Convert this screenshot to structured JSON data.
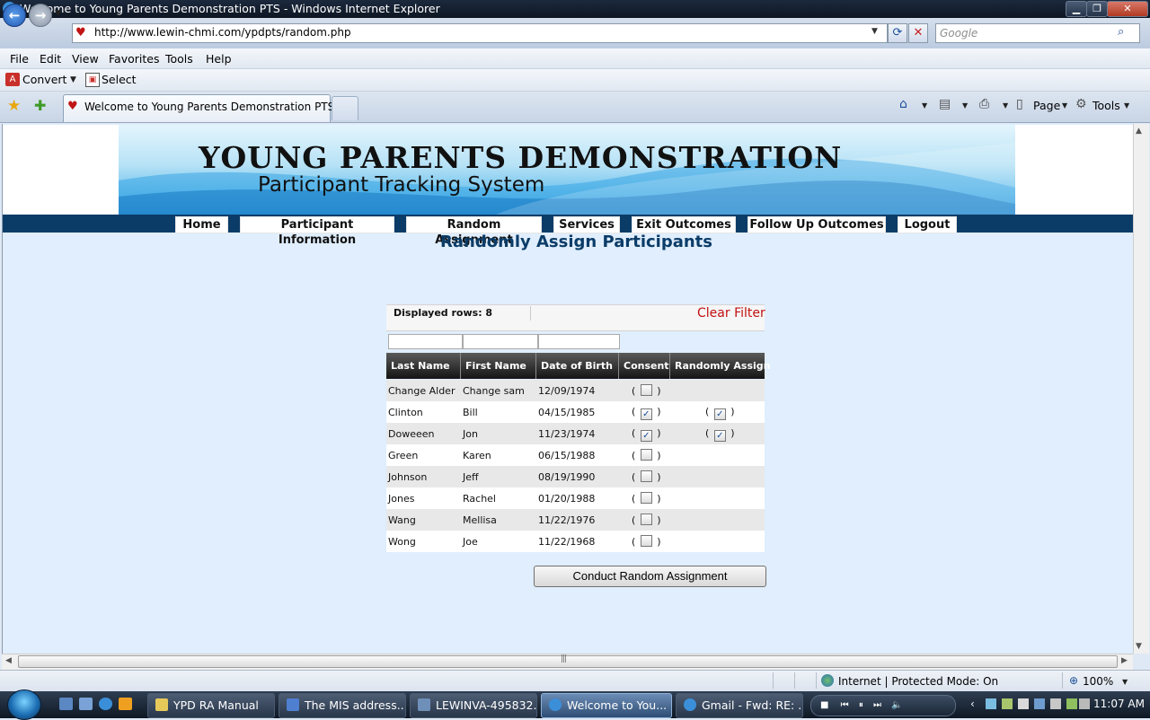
{
  "window": {
    "title": "Welcome to Young Parents Demonstration PTS - Windows Internet Explorer",
    "min": "▁",
    "max": "❐",
    "close": "✕"
  },
  "browser": {
    "address": "http://www.lewin-chmi.com/ypdpts/random.php",
    "search_placeholder": "Google",
    "menu": [
      "File",
      "Edit",
      "View",
      "Favorites",
      "Tools",
      "Help"
    ],
    "convert_label": "Convert",
    "select_label": "Select",
    "tab_title": "Welcome to Young Parents Demonstration PTS",
    "page_label": "Page",
    "tools_label": "Tools",
    "zone": "Internet | Protected Mode: On",
    "zoom": "100%"
  },
  "site": {
    "banner_title": "YOUNG PARENTS DEMONSTRATION",
    "banner_subtitle": "Participant Tracking System",
    "nav": [
      "Home",
      "Participant Information",
      "Random Assignment",
      "Services",
      "Exit Outcomes",
      "Follow Up Outcomes",
      "Logout"
    ],
    "heading": "Randomly Assign Participants"
  },
  "table": {
    "displayed_rows_label": "Displayed rows: 8",
    "clear_filter": "Clear Filter",
    "columns": [
      "Last Name",
      "First Name",
      "Date of Birth",
      "Consent",
      "Randomly Assign"
    ],
    "rows": [
      {
        "last": "Change Alder",
        "first": "Change sam",
        "dob": "12/09/1974",
        "consent": false,
        "assign": null
      },
      {
        "last": "Clinton",
        "first": "Bill",
        "dob": "04/15/1985",
        "consent": true,
        "assign": true
      },
      {
        "last": "Doweeen",
        "first": "Jon",
        "dob": "11/23/1974",
        "consent": true,
        "assign": true
      },
      {
        "last": "Green",
        "first": "Karen",
        "dob": "06/15/1988",
        "consent": false,
        "assign": null
      },
      {
        "last": "Johnson",
        "first": "Jeff",
        "dob": "08/19/1990",
        "consent": false,
        "assign": null
      },
      {
        "last": "Jones",
        "first": "Rachel",
        "dob": "01/20/1988",
        "consent": false,
        "assign": null
      },
      {
        "last": "Wang",
        "first": "Mellisa",
        "dob": "11/22/1976",
        "consent": false,
        "assign": null
      },
      {
        "last": "Wong",
        "first": "Joe",
        "dob": "11/22/1968",
        "consent": false,
        "assign": null
      }
    ],
    "button": "Conduct Random Assignment"
  },
  "taskbar": {
    "tasks": [
      "YPD RA Manual",
      "The MIS address....",
      "LEWINVA-495832...",
      "Welcome to You...",
      "Gmail - Fwd: RE: ..."
    ],
    "clock": "11:07 AM"
  },
  "colors": {
    "nav_bar": "#0b3c68",
    "heading": "#0b3c68",
    "clear_filter": "#c11010",
    "table_header": "#141414",
    "content_bg": "#e0eefd"
  }
}
